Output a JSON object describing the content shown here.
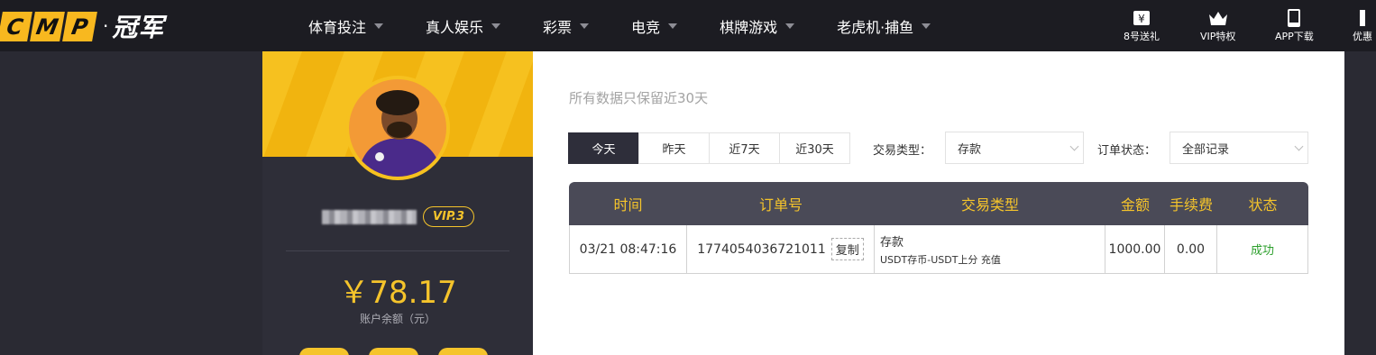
{
  "logo": {
    "letters": [
      "C",
      "M",
      "P"
    ],
    "dot": "·",
    "cn": "冠军"
  },
  "nav": [
    {
      "label": "体育投注"
    },
    {
      "label": "真人娱乐"
    },
    {
      "label": "彩票"
    },
    {
      "label": "电竞"
    },
    {
      "label": "棋牌游戏"
    },
    {
      "label": "老虎机·捕鱼"
    }
  ],
  "quick": [
    {
      "label": "8号送礼",
      "icon": "gift-ticket-icon"
    },
    {
      "label": "VIP特权",
      "icon": "crown-icon"
    },
    {
      "label": "APP下载",
      "icon": "phone-icon"
    },
    {
      "label": "优惠",
      "icon": "promo-icon"
    }
  ],
  "profile": {
    "vip": "VIP.3",
    "balance": "￥78.17",
    "balance_label": "账户余额（元）"
  },
  "page": {
    "subtitle": "所有数据只保留近30天"
  },
  "filters": {
    "ranges": [
      "今天",
      "昨天",
      "近7天",
      "近30天"
    ],
    "active_range": "今天",
    "type_label": "交易类型：",
    "type_value": "存款",
    "status_label": "订单状态：",
    "status_value": "全部记录"
  },
  "table": {
    "headers": [
      "时间",
      "订单号",
      "交易类型",
      "金额",
      "手续费",
      "状态"
    ],
    "rows": [
      {
        "time": "03/21 08:47:16",
        "order_no": "1774054036721011",
        "copy": "复制",
        "type": "存款",
        "type_detail": "USDT存币-USDT上分 充值",
        "amount": "1000.00",
        "fee": "0.00",
        "status": "成功"
      }
    ]
  },
  "colors": {
    "accent": "#f5c42b",
    "topbar": "#1c1c22",
    "panel": "#2e2e38",
    "header_row": "#4a4a57",
    "success": "#2c9f2c"
  }
}
